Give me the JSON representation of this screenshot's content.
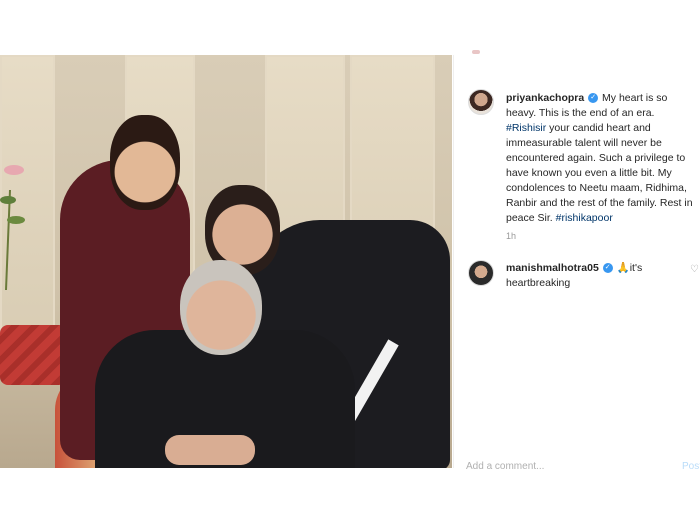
{
  "post": {
    "comments": [
      {
        "username": "priyankachopra",
        "verified_icon": "verified-badge-icon",
        "text_parts": [
          {
            "text": "My heart is so heavy. This is the end of an era. ",
            "tag": false
          },
          {
            "text": "#Rishisir",
            "tag": true
          },
          {
            "text": " your candid heart and immeasurable talent will never be encountered again. Such a privilege to have known you even a little bit. My condolences to Neetu maam, Ridhima, Ranbir and the rest of the family. Rest in peace Sir. ",
            "tag": false
          },
          {
            "text": "#rishikapoor",
            "tag": true
          }
        ],
        "time": "1h"
      },
      {
        "username": "manishmalhotra05",
        "verified_icon": "verified-badge-icon",
        "emoji": "🙏",
        "text": "it's heartbreaking"
      }
    ],
    "add_comment_placeholder": "Add a comment...",
    "post_button": "Post"
  },
  "colors": {
    "link": "#003569",
    "verified": "#3897f0",
    "muted": "#999999"
  }
}
